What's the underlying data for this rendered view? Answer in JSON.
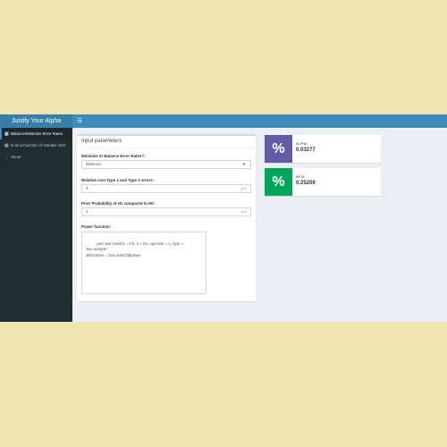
{
  "header": {
    "title": "Justify Your Alpha",
    "toggle_icon": "bars-icon"
  },
  "sidebar": {
    "items": [
      {
        "label": "Balance/Minimize Error Rates",
        "icon": "table-icon",
        "active": true
      },
      {
        "label": "N as a Function of Sample Size",
        "icon": "table-icon",
        "active": false
      },
      {
        "label": "About",
        "icon": "info-icon",
        "active": false
      }
    ]
  },
  "input_box": {
    "title": "Input parameters",
    "minimize_label": "Minimize or Balance Error Rates?:",
    "minimize_value": "Minimize",
    "cost_label": "Relative cost Type 1 and Type 2 errors:",
    "cost_value": "4",
    "prior_label": "Prior Probability of H1 compared to H0:",
    "prior_value": "1",
    "power_label": "Power function:",
    "power_value": "pwr::pwr.t.test(d = 0.5, n = 64, sig.level = x, type = 'two.sample',\nalternative = 'two.sided')$power"
  },
  "alpha_box": {
    "label": "ALPHA",
    "value": "0.03277",
    "color": "#605ca8",
    "icon": "percent-icon"
  },
  "beta_box": {
    "label": "BETA",
    "value": "0.25209",
    "color": "#00a65a",
    "icon": "percent-icon"
  }
}
